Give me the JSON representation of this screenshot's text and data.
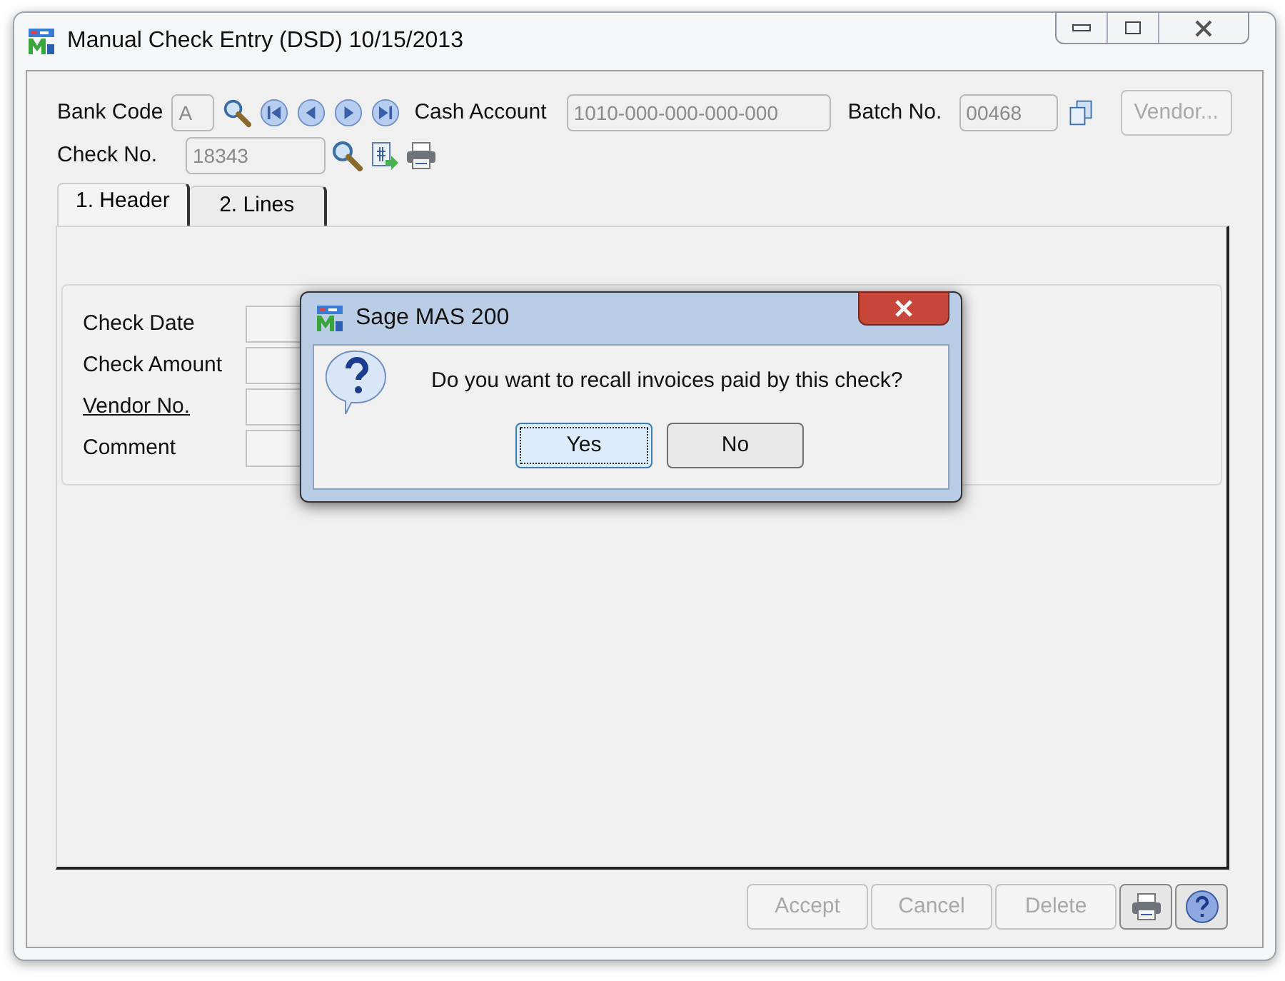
{
  "window": {
    "title": "Manual Check Entry (DSD) 10/15/2013"
  },
  "toolbar": {
    "bank_code": {
      "label": "Bank Code",
      "value": "A"
    },
    "cash_account": {
      "label": "Cash Account",
      "value": "1010-000-000-000-000"
    },
    "batch_no": {
      "label": "Batch No.",
      "value": "00468"
    },
    "check_no": {
      "label": "Check No.",
      "value": "18343"
    },
    "vendor_button": {
      "label": "Vendor...",
      "disabled": true
    }
  },
  "tabs": [
    {
      "label": "1. Header",
      "selected": true
    },
    {
      "label": "2. Lines",
      "selected": false
    }
  ],
  "header_fields": [
    {
      "label": "Check Date",
      "kind": "plain"
    },
    {
      "label": "Check Amount",
      "kind": "plain"
    },
    {
      "label": "Vendor No.",
      "kind": "link"
    },
    {
      "label": "Comment",
      "kind": "plain"
    }
  ],
  "footer_buttons": [
    {
      "label": "Accept",
      "disabled": true
    },
    {
      "label": "Cancel",
      "disabled": true
    },
    {
      "label": "Delete",
      "disabled": true
    }
  ],
  "dialog": {
    "title": "Sage MAS 200",
    "message": "Do you want to recall invoices paid by this check?",
    "buttons": [
      {
        "label": "Yes",
        "selected": true
      },
      {
        "label": "No",
        "selected": false
      }
    ]
  }
}
